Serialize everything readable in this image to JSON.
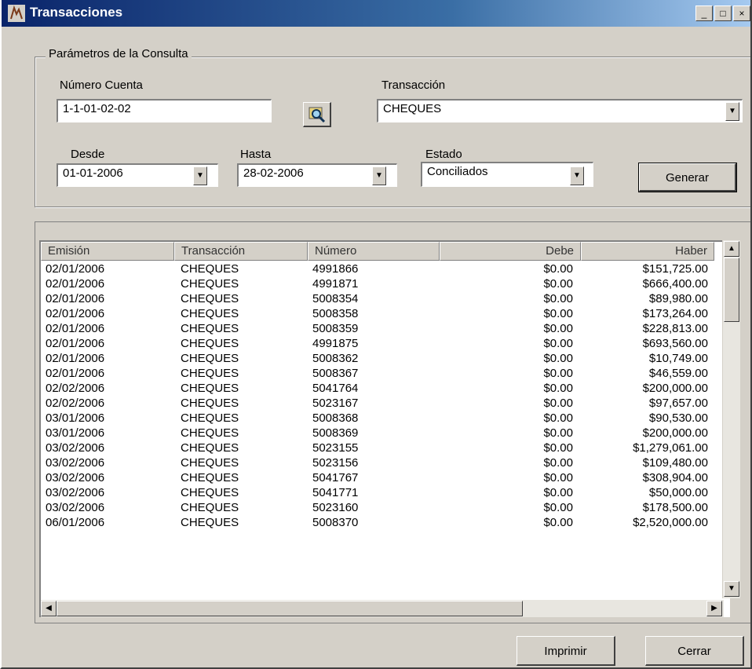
{
  "window": {
    "title": "Transacciones",
    "minimize": "_",
    "maximize": "□",
    "close": "×"
  },
  "params": {
    "legend": "Parámetros de la Consulta",
    "cuenta_label": "Número Cuenta",
    "cuenta_value": "1-1-01-02-02",
    "transaccion_label": "Transacción",
    "transaccion_value": "CHEQUES",
    "desde_label": "Desde",
    "desde_value": "01-01-2006",
    "hasta_label": "Hasta",
    "hasta_value": "28-02-2006",
    "estado_label": "Estado",
    "estado_value": "Conciliados",
    "generar_label": "Generar"
  },
  "table": {
    "columns": [
      "Emisión",
      "Transacción",
      "Número",
      "Debe",
      "Haber"
    ],
    "rows": [
      [
        "02/01/2006",
        "CHEQUES",
        "4991866",
        "$0.00",
        "$151,725.00"
      ],
      [
        "02/01/2006",
        "CHEQUES",
        "4991871",
        "$0.00",
        "$666,400.00"
      ],
      [
        "02/01/2006",
        "CHEQUES",
        "5008354",
        "$0.00",
        "$89,980.00"
      ],
      [
        "02/01/2006",
        "CHEQUES",
        "5008358",
        "$0.00",
        "$173,264.00"
      ],
      [
        "02/01/2006",
        "CHEQUES",
        "5008359",
        "$0.00",
        "$228,813.00"
      ],
      [
        "02/01/2006",
        "CHEQUES",
        "4991875",
        "$0.00",
        "$693,560.00"
      ],
      [
        "02/01/2006",
        "CHEQUES",
        "5008362",
        "$0.00",
        "$10,749.00"
      ],
      [
        "02/01/2006",
        "CHEQUES",
        "5008367",
        "$0.00",
        "$46,559.00"
      ],
      [
        "02/02/2006",
        "CHEQUES",
        "5041764",
        "$0.00",
        "$200,000.00"
      ],
      [
        "02/02/2006",
        "CHEQUES",
        "5023167",
        "$0.00",
        "$97,657.00"
      ],
      [
        "03/01/2006",
        "CHEQUES",
        "5008368",
        "$0.00",
        "$90,530.00"
      ],
      [
        "03/01/2006",
        "CHEQUES",
        "5008369",
        "$0.00",
        "$200,000.00"
      ],
      [
        "03/02/2006",
        "CHEQUES",
        "5023155",
        "$0.00",
        "$1,279,061.00"
      ],
      [
        "03/02/2006",
        "CHEQUES",
        "5023156",
        "$0.00",
        "$109,480.00"
      ],
      [
        "03/02/2006",
        "CHEQUES",
        "5041767",
        "$0.00",
        "$308,904.00"
      ],
      [
        "03/02/2006",
        "CHEQUES",
        "5041771",
        "$0.00",
        "$50,000.00"
      ],
      [
        "03/02/2006",
        "CHEQUES",
        "5023160",
        "$0.00",
        "$178,500.00"
      ],
      [
        "06/01/2006",
        "CHEQUES",
        "5008370",
        "$0.00",
        "$2,520,000.00"
      ]
    ]
  },
  "footer": {
    "imprimir_label": "Imprimir",
    "cerrar_label": "Cerrar"
  },
  "icons": {
    "app": "app-icon",
    "search": "magnifier-search-icon",
    "dropdown": "chevron-down-icon"
  },
  "colors": {
    "title_bar": "#0a246a",
    "face": "#d4d0c8"
  }
}
